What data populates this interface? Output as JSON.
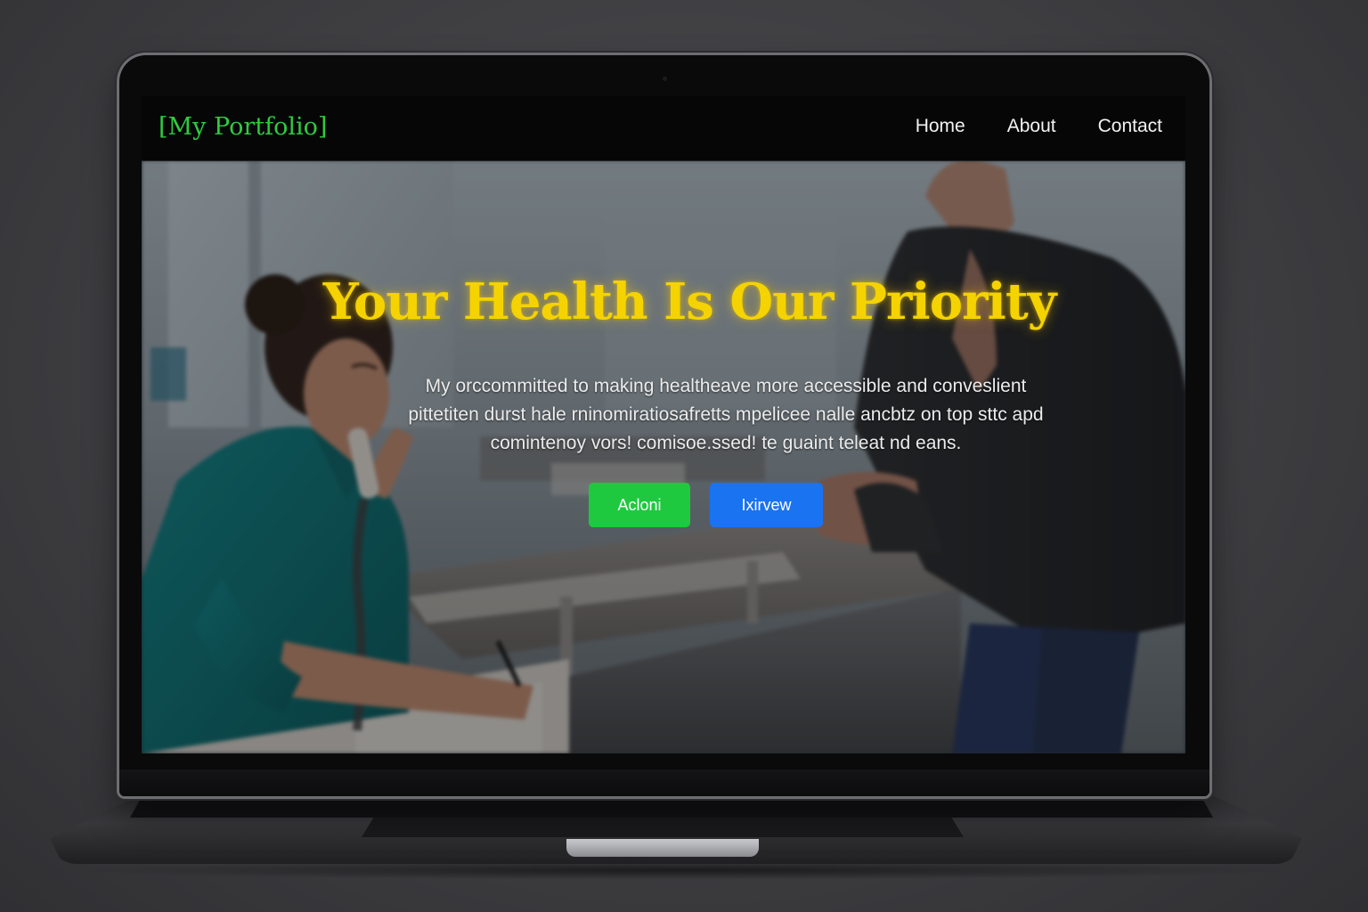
{
  "brand": "[My Portfolio]",
  "nav": {
    "items": [
      {
        "label": "Home"
      },
      {
        "label": "About"
      },
      {
        "label": "Contact"
      }
    ]
  },
  "hero": {
    "title": "Your Health Is Our Priority",
    "paragraph_lines": [
      "My orccommitted to making healtheave more accessible and conveslient",
      "pittetiten durst hale rninomiratiosafretts mpelicee nalle ancbtz on top sttc apd",
      "comintenoy vors! comisoe.ssed! te guaint teleat nd eans."
    ],
    "buttons": {
      "primary_label": "Acloni",
      "secondary_label": "Ixirvew"
    }
  },
  "colors": {
    "brand": "#2ecc40",
    "title": "#f5d300",
    "primary_button": "#1ec93f",
    "secondary_button": "#1a73f0",
    "navbar": "#060607"
  }
}
